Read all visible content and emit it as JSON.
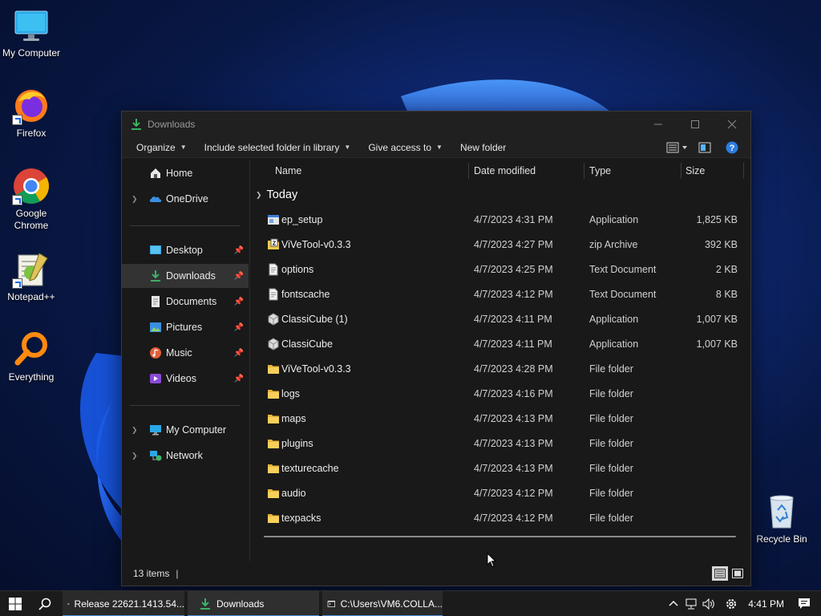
{
  "desktop": {
    "icons": [
      {
        "label": "My Computer"
      },
      {
        "label": "Firefox"
      },
      {
        "label": "Google Chrome"
      },
      {
        "label": "Notepad++"
      },
      {
        "label": "Everything"
      },
      {
        "label": "Recycle Bin"
      }
    ]
  },
  "window": {
    "title": "Downloads",
    "toolbar": {
      "organize": "Organize",
      "include_library": "Include selected folder in library",
      "give_access": "Give access to",
      "new_folder": "New folder"
    },
    "nav": {
      "home": "Home",
      "onedrive": "OneDrive",
      "desktop": "Desktop",
      "downloads": "Downloads",
      "documents": "Documents",
      "pictures": "Pictures",
      "music": "Music",
      "videos": "Videos",
      "my_computer": "My Computer",
      "network": "Network"
    },
    "columns": {
      "name": "Name",
      "date": "Date modified",
      "type": "Type",
      "size": "Size"
    },
    "group": "Today",
    "files": [
      {
        "name": "ep_setup",
        "date": "4/7/2023 4:31 PM",
        "type": "Application",
        "size": "1,825 KB",
        "icon": "app-icon"
      },
      {
        "name": "ViVeTool-v0.3.3",
        "date": "4/7/2023 4:27 PM",
        "type": "zip Archive",
        "size": "392 KB",
        "icon": "zip-icon"
      },
      {
        "name": "options",
        "date": "4/7/2023 4:25 PM",
        "type": "Text Document",
        "size": "2 KB",
        "icon": "text-icon"
      },
      {
        "name": "fontscache",
        "date": "4/7/2023 4:12 PM",
        "type": "Text Document",
        "size": "8 KB",
        "icon": "text-icon"
      },
      {
        "name": "ClassiCube (1)",
        "date": "4/7/2023 4:11 PM",
        "type": "Application",
        "size": "1,007 KB",
        "icon": "cube-icon"
      },
      {
        "name": "ClassiCube",
        "date": "4/7/2023 4:11 PM",
        "type": "Application",
        "size": "1,007 KB",
        "icon": "cube-icon"
      },
      {
        "name": "ViVeTool-v0.3.3",
        "date": "4/7/2023 4:28 PM",
        "type": "File folder",
        "size": "",
        "icon": "folder-icon"
      },
      {
        "name": "logs",
        "date": "4/7/2023 4:16 PM",
        "type": "File folder",
        "size": "",
        "icon": "folder-icon"
      },
      {
        "name": "maps",
        "date": "4/7/2023 4:13 PM",
        "type": "File folder",
        "size": "",
        "icon": "folder-icon"
      },
      {
        "name": "plugins",
        "date": "4/7/2023 4:13 PM",
        "type": "File folder",
        "size": "",
        "icon": "folder-icon"
      },
      {
        "name": "texturecache",
        "date": "4/7/2023 4:13 PM",
        "type": "File folder",
        "size": "",
        "icon": "folder-icon"
      },
      {
        "name": "audio",
        "date": "4/7/2023 4:12 PM",
        "type": "File folder",
        "size": "",
        "icon": "folder-icon"
      },
      {
        "name": "texpacks",
        "date": "4/7/2023 4:12 PM",
        "type": "File folder",
        "size": "",
        "icon": "folder-icon"
      }
    ],
    "status": {
      "items": "13 items",
      "caret": "|"
    }
  },
  "taskbar": {
    "chrome_label": "Release 22621.1413.54...",
    "explorer_label": "Downloads",
    "cmd_label": "C:\\Users\\VM6.COLLA...",
    "time": "4:41 PM"
  },
  "colors": {
    "accent": "#4a90d9",
    "folder": "#f2c84b",
    "window_bg": "#191919"
  }
}
